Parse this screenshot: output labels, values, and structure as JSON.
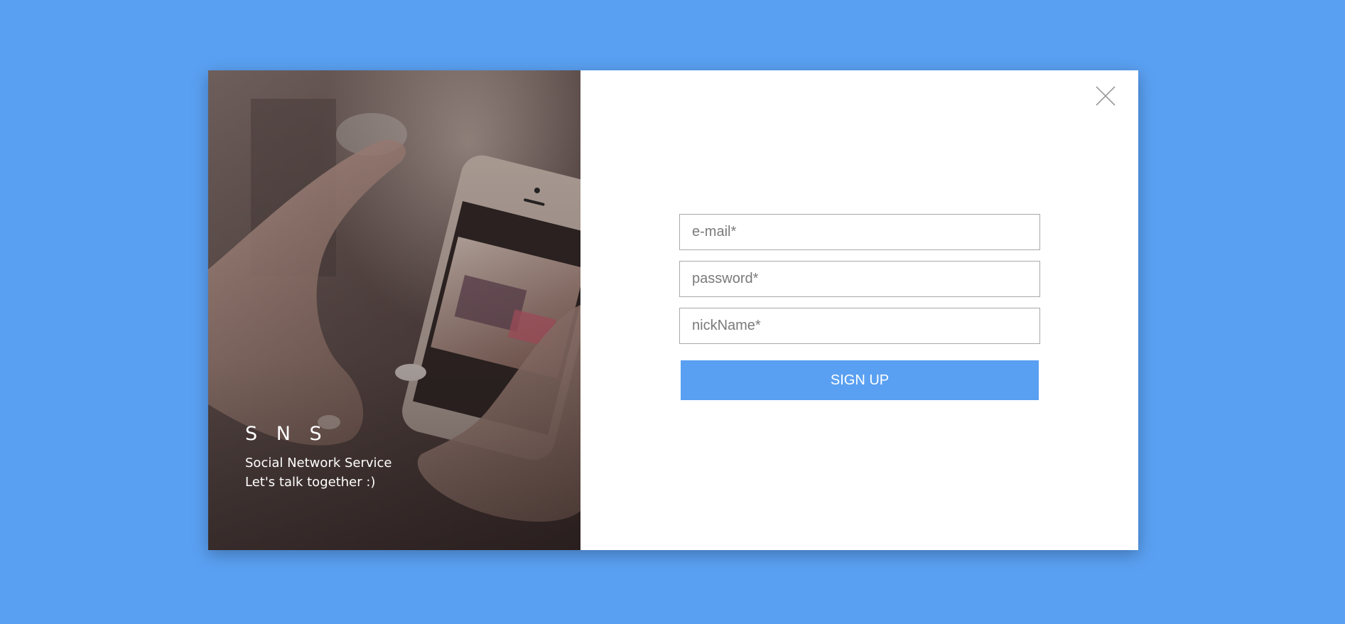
{
  "colors": {
    "background": "#5aa0f2",
    "accent": "#5aa0f2",
    "modal": "#ffffff"
  },
  "brand": {
    "title": "S N S",
    "line1": "Social Network Service",
    "line2": "Let's talk together :)"
  },
  "form": {
    "email_placeholder": "e-mail*",
    "password_placeholder": "password*",
    "nickname_placeholder": "nickName*",
    "submit_label": "SIGN UP"
  },
  "icons": {
    "close": "close-icon"
  }
}
